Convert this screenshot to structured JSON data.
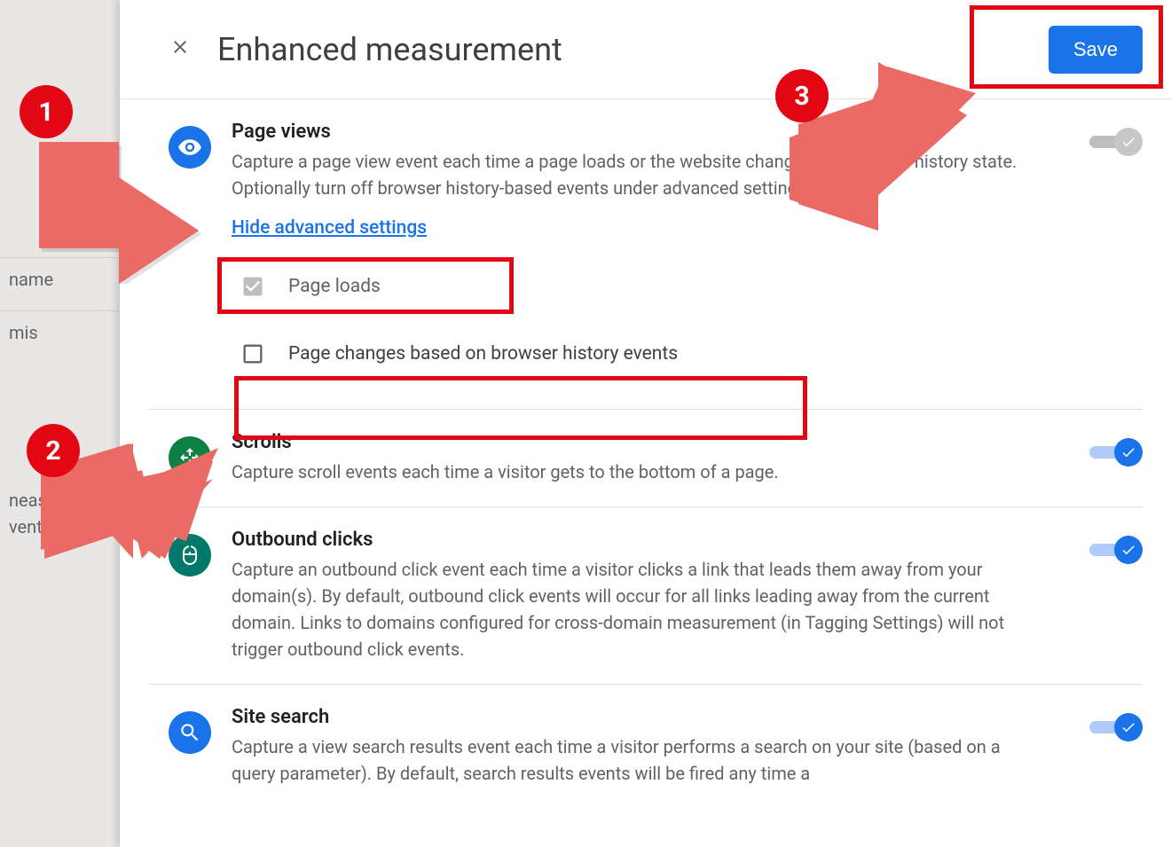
{
  "header": {
    "title": "Enhanced measurement",
    "save_label": "Save"
  },
  "sections": {
    "pageviews": {
      "title": "Page views",
      "desc": "Capture a page view event each time a page loads or the website changes the browser history state. Optionally turn off browser history-based events under advanced settings.",
      "advanced_link": "Hide advanced settings",
      "opt1": "Page loads",
      "opt2": "Page changes based on browser history events"
    },
    "scrolls": {
      "title": "Scrolls",
      "desc": "Capture scroll events each time a visitor gets to the bottom of a page."
    },
    "outbound": {
      "title": "Outbound clicks",
      "desc": "Capture an outbound click event each time a visitor clicks a link that leads them away from your domain(s). By default, outbound click events will occur for all links leading away from the current domain. Links to domains configured for cross-domain measurement (in Tagging Settings) will not trigger outbound click events."
    },
    "sitesearch": {
      "title": "Site search",
      "desc": "Capture a view search results event each time a visitor performs a search on your site (based on a query parameter). By default, search results events will be fired any time a"
    }
  },
  "annotations": {
    "1": "1",
    "2": "2",
    "3": "3"
  },
  "bg": {
    "label_name": "name",
    "label_mis": "mis",
    "label_measurement": "neasurement.",
    "label_events": "vents. You mu"
  }
}
